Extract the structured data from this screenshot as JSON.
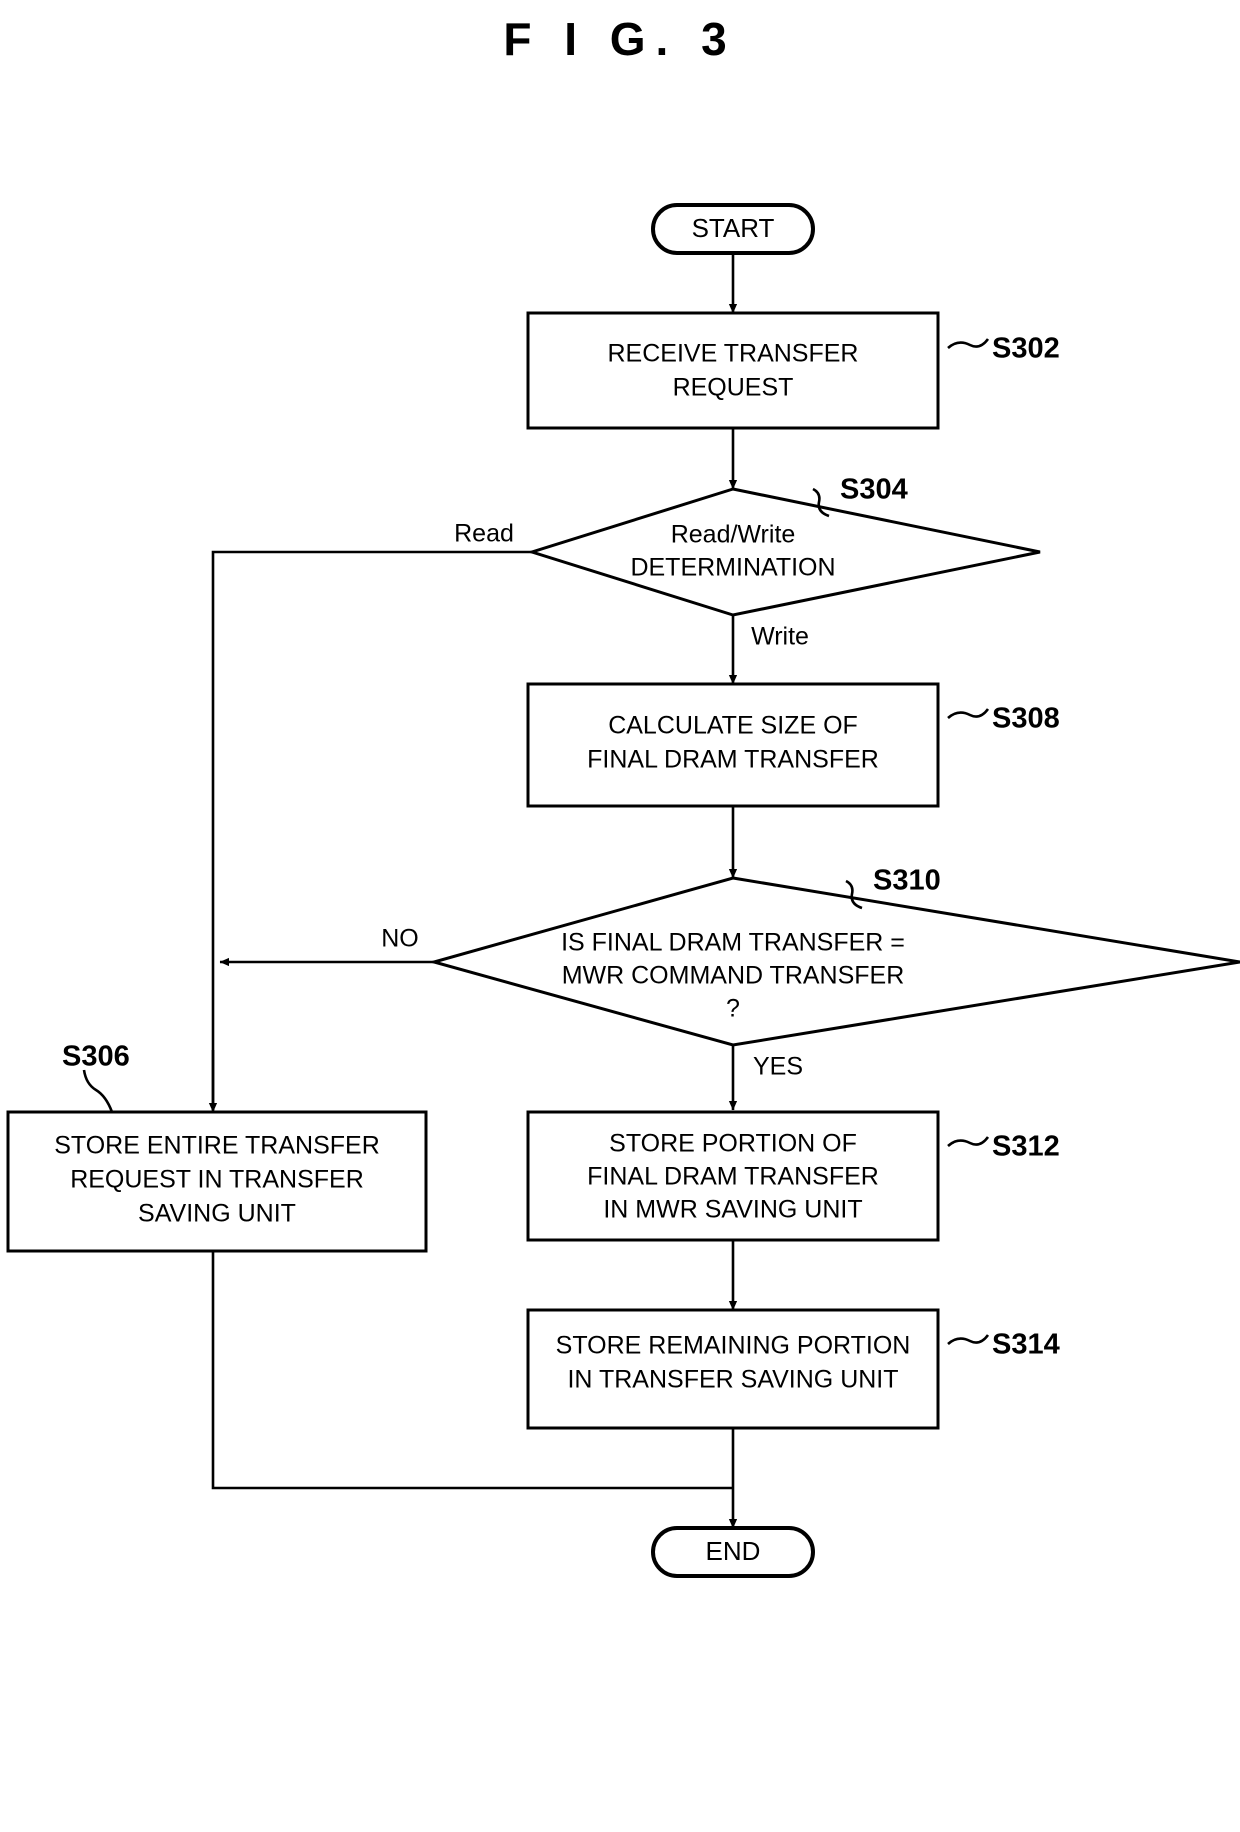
{
  "figure": {
    "title": "F I G.  3"
  },
  "colors": {
    "stroke": "#000000",
    "background": "#ffffff",
    "text": "#000000"
  },
  "nodes": {
    "start": {
      "label": "START",
      "type": "terminator"
    },
    "s302": {
      "step": "S302",
      "type": "process",
      "lines": [
        "RECEIVE TRANSFER",
        "REQUEST"
      ]
    },
    "s304": {
      "step": "S304",
      "type": "decision",
      "lines": [
        "Read/Write",
        "DETERMINATION"
      ]
    },
    "s308": {
      "step": "S308",
      "type": "process",
      "lines": [
        "CALCULATE SIZE OF",
        "FINAL DRAM TRANSFER"
      ]
    },
    "s310": {
      "step": "S310",
      "type": "decision",
      "lines": [
        "IS FINAL DRAM TRANSFER =",
        "MWR COMMAND TRANSFER",
        "?"
      ]
    },
    "s306": {
      "step": "S306",
      "type": "process",
      "lines": [
        "STORE ENTIRE TRANSFER",
        "REQUEST IN TRANSFER",
        "SAVING UNIT"
      ]
    },
    "s312": {
      "step": "S312",
      "type": "process",
      "lines": [
        "STORE PORTION OF",
        "FINAL DRAM TRANSFER",
        "IN MWR SAVING UNIT"
      ]
    },
    "s314": {
      "step": "S314",
      "type": "process",
      "lines": [
        "STORE REMAINING PORTION",
        "IN TRANSFER SAVING UNIT"
      ]
    },
    "end": {
      "label": "END",
      "type": "terminator"
    }
  },
  "edge_labels": {
    "read": "Read",
    "write": "Write",
    "no": "NO",
    "yes": "YES"
  },
  "flow": [
    {
      "from": "start",
      "to": "s302"
    },
    {
      "from": "s302",
      "to": "s304"
    },
    {
      "from": "s304",
      "to": "s306",
      "label": "Read"
    },
    {
      "from": "s304",
      "to": "s308",
      "label": "Write"
    },
    {
      "from": "s308",
      "to": "s310"
    },
    {
      "from": "s310",
      "to": "s306",
      "label": "NO"
    },
    {
      "from": "s310",
      "to": "s312",
      "label": "YES"
    },
    {
      "from": "s312",
      "to": "s314"
    },
    {
      "from": "s314",
      "to": "end"
    },
    {
      "from": "s306",
      "to": "end"
    }
  ]
}
